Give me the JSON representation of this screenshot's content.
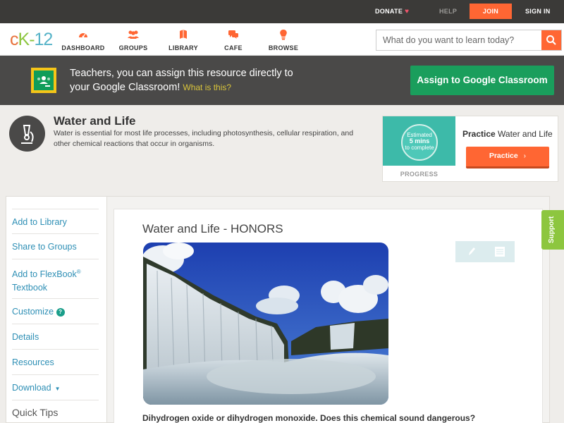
{
  "topbar": {
    "donate": "DONATE",
    "help": "HELP",
    "join": "JOIN",
    "sign_in": "SIGN IN"
  },
  "nav": {
    "logo": {
      "c": "c",
      "k": "K",
      "dash": "-",
      "num": "12"
    },
    "items": [
      {
        "label": "DASHBOARD",
        "icon": "dashboard-icon"
      },
      {
        "label": "GROUPS",
        "icon": "groups-icon"
      },
      {
        "label": "LIBRARY",
        "icon": "library-icon"
      },
      {
        "label": "CAFE",
        "icon": "cafe-icon"
      },
      {
        "label": "BROWSE",
        "icon": "browse-icon"
      }
    ],
    "search_placeholder": "What do you want to learn today?"
  },
  "classroom": {
    "line1": "Teachers, you can assign this resource directly to",
    "line2": "your Google Classroom!",
    "what": "What is this?",
    "button": "Assign to Google Classroom"
  },
  "concept": {
    "title": "Water and Life",
    "description": "Water is essential for most life processes, including photosynthesis, cellular respiration, and other chemical reactions that occur in organisms.",
    "icon": "microscope-icon"
  },
  "practice": {
    "estimate_line1": "Estimated",
    "estimate_line2": "5 mins",
    "estimate_line3": "to complete",
    "progress_label": "PROGRESS",
    "heading_bold": "Practice",
    "heading_rest": " Water and Life",
    "button": "Practice"
  },
  "sidebar": {
    "items": [
      "Add to Library",
      "Share to Groups",
      "Add to FlexBook",
      "Customize",
      "Details",
      "Resources",
      "Download"
    ],
    "flexbook_reg": "®",
    "flexbook_second": "Textbook",
    "customize_help": "?",
    "quick_tips": "Quick Tips"
  },
  "main": {
    "title": "Water and Life - HONORS",
    "caption": "Dihydrogen oxide or dihydrogen monoxide. Does this chemical sound dangerous?"
  },
  "support": "Support",
  "colors": {
    "accent": "#ff6633",
    "green": "#8dc63f",
    "classroom_green": "#1a9e5c",
    "link": "#2e8fb5"
  }
}
